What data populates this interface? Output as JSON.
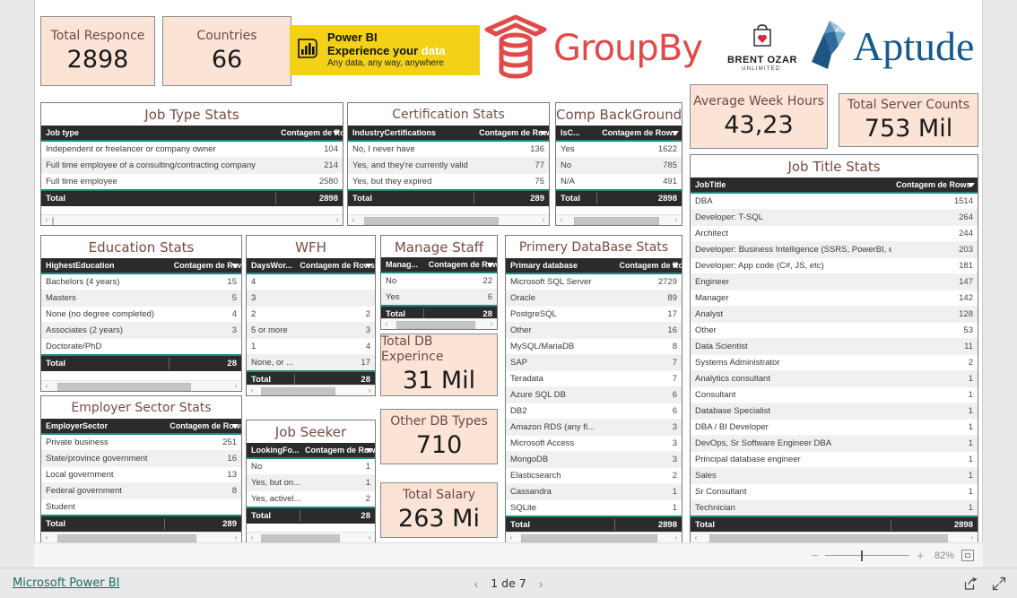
{
  "kpis": [
    {
      "id": "total-responce",
      "title": "Total Responce",
      "value": "2898"
    },
    {
      "id": "countries",
      "title": "Countries",
      "value": "66"
    },
    {
      "id": "average-week-hours",
      "title": "Average Week Hours",
      "value": "43,23"
    },
    {
      "id": "total-server-counts",
      "title": "Total Server Counts",
      "value": "753 Mil"
    },
    {
      "id": "total-db-experince",
      "title": "Total DB Experince",
      "value": "31 Mil"
    },
    {
      "id": "other-db-types",
      "title": "Other DB Types",
      "value": "710"
    },
    {
      "id": "total-salary",
      "title": "Total Salary",
      "value": "263 Mi"
    }
  ],
  "logos": {
    "powerbi": {
      "line1": "Power BI",
      "line2a": "Experience your ",
      "line2b": "data",
      "line3": "Any data, any way, anywhere"
    },
    "groupby": {
      "text": "GroupBy"
    },
    "brent": {
      "line1": "BRENT OZAR",
      "line2": "UNLIMITED’"
    },
    "aptude": {
      "text": "Aptude"
    }
  },
  "measure_header": "Contagem de Rows",
  "total_label": "Total",
  "panels": {
    "job_type": {
      "title": "Job Type Stats",
      "col_label": "Job type",
      "col_value": "Contagem de Rows",
      "rows": [
        {
          "label": "Independent or freelancer or company owner",
          "value": "104"
        },
        {
          "label": "Full time employee of a consulting/contracting company",
          "value": "214"
        },
        {
          "label": "Full time employee",
          "value": "2580"
        }
      ],
      "total": {
        "label": "Total",
        "value": "2898"
      }
    },
    "certification": {
      "title": "Certification Stats",
      "col_label": "IndustryCertifications",
      "col_value": "Contagem de Rows",
      "rows": [
        {
          "label": "No, I never have",
          "value": "136"
        },
        {
          "label": "Yes, and they're currently valid",
          "value": "77"
        },
        {
          "label": "Yes, but they expired",
          "value": "75"
        }
      ],
      "total": {
        "label": "Total",
        "value": "289"
      }
    },
    "comp_background": {
      "title": "Comp BackGround",
      "col_label": "IsC...",
      "col_value": "Contagem de Rows",
      "rows": [
        {
          "label": "Yes",
          "value": "1622"
        },
        {
          "label": "No",
          "value": "785"
        },
        {
          "label": "N/A",
          "value": "491"
        }
      ],
      "total": {
        "label": "Total",
        "value": "2898"
      }
    },
    "job_title": {
      "title": "Job Title Stats",
      "col_label": "JobTitle",
      "col_value": "Contagem de Rows",
      "rows": [
        {
          "label": "DBA",
          "value": "1514"
        },
        {
          "label": "Developer: T-SQL",
          "value": "264"
        },
        {
          "label": "Architect",
          "value": "244"
        },
        {
          "label": "Developer: Business Intelligence (SSRS, PowerBI, etc)",
          "value": "203"
        },
        {
          "label": "Developer: App code (C#, JS, etc)",
          "value": "181"
        },
        {
          "label": "Engineer",
          "value": "147"
        },
        {
          "label": "Manager",
          "value": "142"
        },
        {
          "label": "Analyst",
          "value": "128"
        },
        {
          "label": "Other",
          "value": "53"
        },
        {
          "label": "Data Scientist",
          "value": "11"
        },
        {
          "label": "Systems Administrator",
          "value": "2"
        },
        {
          "label": "Analytics consultant",
          "value": "1"
        },
        {
          "label": "Consultant",
          "value": "1"
        },
        {
          "label": "Database Specialist",
          "value": "1"
        },
        {
          "label": "DBA / BI Developer",
          "value": "1"
        },
        {
          "label": "DevOps, Sr Software Engineer DBA",
          "value": "1"
        },
        {
          "label": "Principal database engineer",
          "value": "1"
        },
        {
          "label": "Sales",
          "value": "1"
        },
        {
          "label": "Sr Consultant",
          "value": "1"
        },
        {
          "label": "Technician",
          "value": "1"
        }
      ],
      "total": {
        "label": "Total",
        "value": "2898"
      }
    },
    "education": {
      "title": "Education Stats",
      "col_label": "HighestEducation",
      "col_value": "Contagem de Rows",
      "rows": [
        {
          "label": "Bachelors (4 years)",
          "value": "15"
        },
        {
          "label": "Masters",
          "value": "5"
        },
        {
          "label": "None (no degree completed)",
          "value": "4"
        },
        {
          "label": "Associates (2 years)",
          "value": "3"
        },
        {
          "label": "Doctorate/PhD",
          "value": ""
        }
      ],
      "total": {
        "label": "Total",
        "value": "28"
      }
    },
    "wfh": {
      "title": "WFH",
      "col_label": "DaysWor...",
      "col_value": "Contagem de Rows",
      "rows": [
        {
          "label": "4",
          "value": ""
        },
        {
          "label": "3",
          "value": ""
        },
        {
          "label": "2",
          "value": "2"
        },
        {
          "label": "5 or more",
          "value": "3"
        },
        {
          "label": "1",
          "value": "4"
        },
        {
          "label": "None, or ...",
          "value": "17"
        }
      ],
      "total": {
        "label": "Total",
        "value": "28"
      }
    },
    "manage_staff": {
      "title": "Manage Staff",
      "col_label": "Manag...",
      "col_value": "Contagem de Rows",
      "rows": [
        {
          "label": "No",
          "value": "22"
        },
        {
          "label": "Yes",
          "value": "6"
        }
      ],
      "total": {
        "label": "Total",
        "value": "28"
      }
    },
    "primary_database": {
      "title": "Primery DataBase Stats",
      "col_label": "Primary database",
      "col_value": "Contagem de Rows",
      "rows": [
        {
          "label": "Microsoft SQL Server",
          "value": "2729"
        },
        {
          "label": "Oracle",
          "value": "89"
        },
        {
          "label": "PostgreSQL",
          "value": "17"
        },
        {
          "label": "Other",
          "value": "16"
        },
        {
          "label": "MySQL/MariaDB",
          "value": "8"
        },
        {
          "label": "SAP",
          "value": "7"
        },
        {
          "label": "Teradata",
          "value": "7"
        },
        {
          "label": "Azure SQL DB",
          "value": "6"
        },
        {
          "label": "DB2",
          "value": "6"
        },
        {
          "label": "Amazon RDS (any fl...",
          "value": "3"
        },
        {
          "label": "Microsoft Access",
          "value": "3"
        },
        {
          "label": "MongoDB",
          "value": "3"
        },
        {
          "label": "Elasticsearch",
          "value": "2"
        },
        {
          "label": "Cassandra",
          "value": "1"
        },
        {
          "label": "SQLite",
          "value": "1"
        }
      ],
      "total": {
        "label": "Total",
        "value": "2898"
      }
    },
    "employer_sector": {
      "title": "Employer Sector Stats",
      "col_label": "EmployerSector",
      "col_value": "Contagem de Rows",
      "rows": [
        {
          "label": "Private business",
          "value": "251"
        },
        {
          "label": "State/province government",
          "value": "16"
        },
        {
          "label": "Local government",
          "value": "13"
        },
        {
          "label": "Federal government",
          "value": "8"
        },
        {
          "label": "Student",
          "value": ""
        }
      ],
      "total": {
        "label": "Total",
        "value": "289"
      }
    },
    "job_seeker": {
      "title": "Job Seeker",
      "col_label": "LookingFo...",
      "col_value": "Contagem de Rows",
      "rows": [
        {
          "label": "No",
          "value": "1"
        },
        {
          "label": "Yes, but on...",
          "value": "1"
        },
        {
          "label": "Yes, activel...",
          "value": "2"
        }
      ],
      "total": {
        "label": "Total",
        "value": "28"
      }
    }
  },
  "footer": {
    "zoom_percent": "82%",
    "minus": "−",
    "plus": "+",
    "brand_link": "Microsoft Power BI",
    "page_text": "1 de 7",
    "prev": "‹",
    "next": "›"
  }
}
